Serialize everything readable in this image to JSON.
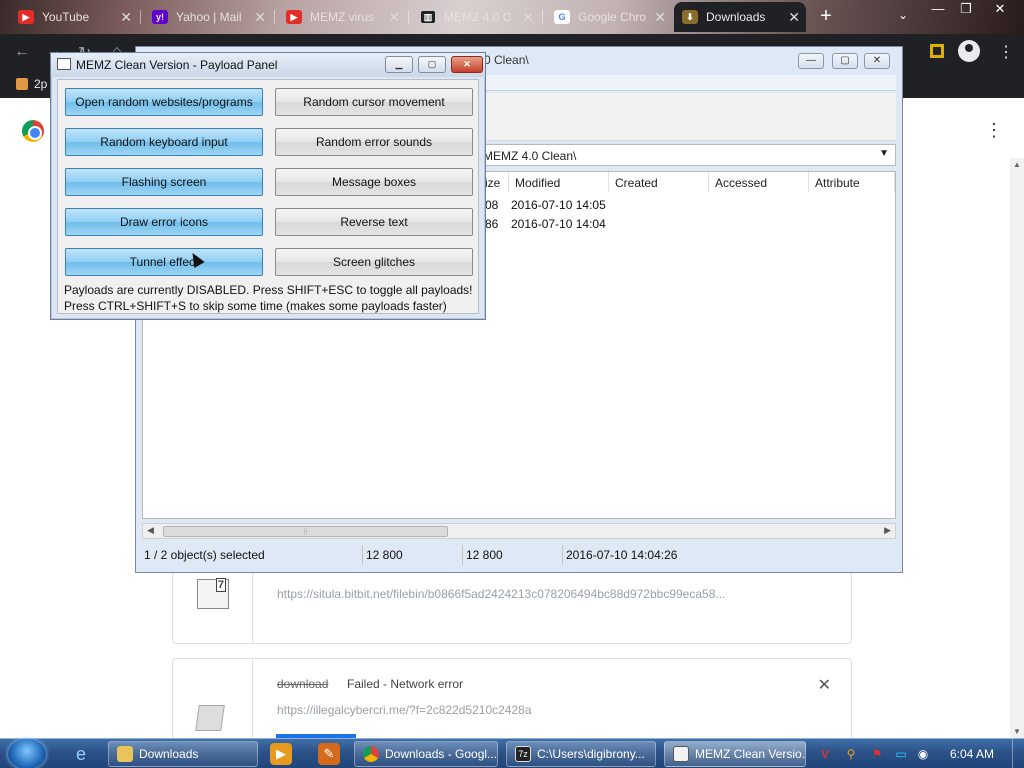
{
  "browser": {
    "tabs": [
      {
        "title": "YouTube",
        "active": false
      },
      {
        "title": "Yahoo | Mail",
        "active": false
      },
      {
        "title": "MEMZ virus",
        "active": false
      },
      {
        "title": "MEMZ 4.0 C",
        "active": false
      },
      {
        "title": "Google Chro",
        "active": false
      },
      {
        "title": "Downloads",
        "active": true
      }
    ],
    "new_tab": "+",
    "bookmark_item": "2p"
  },
  "downloads": {
    "items": [
      {
        "url": "https://situla.bitbit.net/filebin/b0866f5ad2424213c078206494bc88d972bbc99eca58...",
        "icon_text": "7"
      },
      {
        "name": "download",
        "status": "Failed - Network error",
        "url": "https://illegalcybercri.me/?f=2c822d5210c2428a"
      }
    ]
  },
  "explorer": {
    "title": "0 Clean\\",
    "address": "MEMZ 4.0 Clean\\",
    "columns": [
      "ize",
      "Modified",
      "Created",
      "Accessed",
      "Attribute"
    ],
    "rows": [
      {
        "size": "08",
        "modified": "2016-07-10 14:05"
      },
      {
        "size": "86",
        "modified": "2016-07-10 14:04"
      }
    ],
    "status": {
      "selected": "1 / 2 object(s) selected",
      "size1": "12 800",
      "size2": "12 800",
      "timestamp": "2016-07-10 14:04:26"
    }
  },
  "memz": {
    "title": "MEMZ Clean Version - Payload Panel",
    "buttons_left": [
      "Open random websites/programs",
      "Random keyboard input",
      "Flashing screen",
      "Draw error icons",
      "Tunnel effect"
    ],
    "buttons_right": [
      "Random cursor movement",
      "Random error sounds",
      "Message boxes",
      "Reverse text",
      "Screen glitches"
    ],
    "note1": "Payloads are currently DISABLED. Press SHIFT+ESC to toggle all payloads!",
    "note2": "Press CTRL+SHIFT+S to skip some time (makes some payloads faster)"
  },
  "taskbar": {
    "items": [
      {
        "label": "Downloads",
        "icon": "explorer-icon"
      },
      {
        "label": "Downloads - Googl...",
        "icon": "chrome-icon"
      },
      {
        "label": "C:\\Users\\digibrony...",
        "icon": "7zip-icon"
      },
      {
        "label": "MEMZ Clean Versio...",
        "icon": "memz-icon"
      }
    ],
    "clock": "6:04 AM"
  }
}
